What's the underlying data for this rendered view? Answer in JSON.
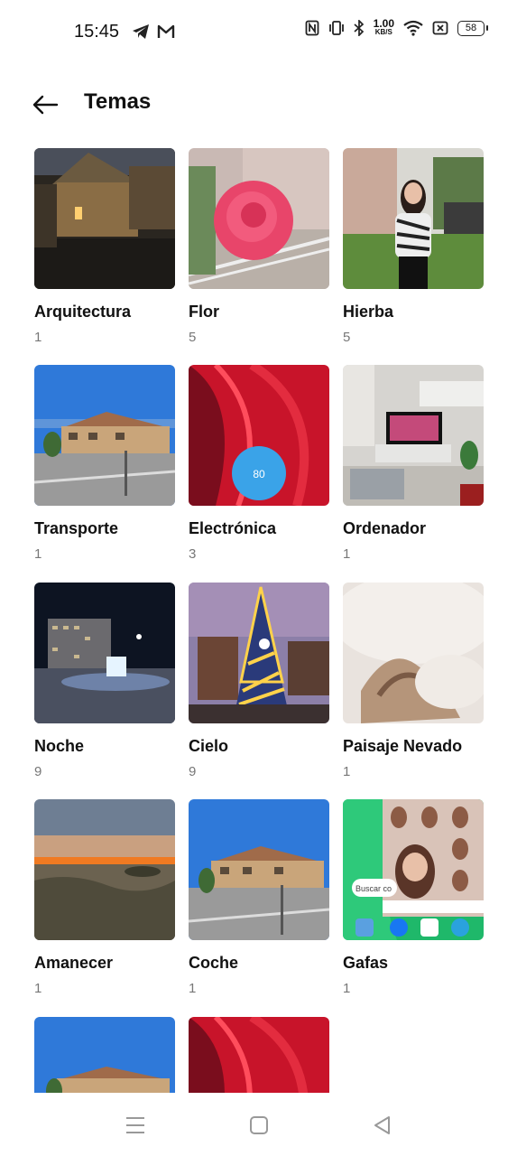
{
  "status_bar": {
    "time": "15:45",
    "left_icons": [
      "telegram-icon",
      "gmail-icon"
    ],
    "right_icons": [
      "nfc-icon",
      "vibrate-icon",
      "bluetooth-icon",
      "wifi-icon",
      "no-sim-icon"
    ],
    "net_speed_value": "1.00",
    "net_speed_unit": "KB/S",
    "battery": "58"
  },
  "header": {
    "title": "Temas",
    "back_icon": "arrow-left-icon"
  },
  "albums": [
    {
      "name": "Arquitectura",
      "count": "1"
    },
    {
      "name": "Flor",
      "count": "5"
    },
    {
      "name": "Hierba",
      "count": "5"
    },
    {
      "name": "Transporte",
      "count": "1"
    },
    {
      "name": "Electrónica",
      "count": "3",
      "thumb_text": "80"
    },
    {
      "name": "Ordenador",
      "count": "1"
    },
    {
      "name": "Noche",
      "count": "9"
    },
    {
      "name": "Cielo",
      "count": "9"
    },
    {
      "name": "Paisaje Nevado",
      "count": "1"
    },
    {
      "name": "Amanecer",
      "count": "1"
    },
    {
      "name": "Coche",
      "count": "1"
    },
    {
      "name": "Gafas",
      "count": "1",
      "thumb_search": "Buscar co"
    },
    {
      "name": "",
      "count": ""
    },
    {
      "name": "",
      "count": ""
    }
  ],
  "nav_bar": {
    "icons": [
      "menu-icon",
      "home-icon",
      "back-triangle-icon"
    ]
  }
}
